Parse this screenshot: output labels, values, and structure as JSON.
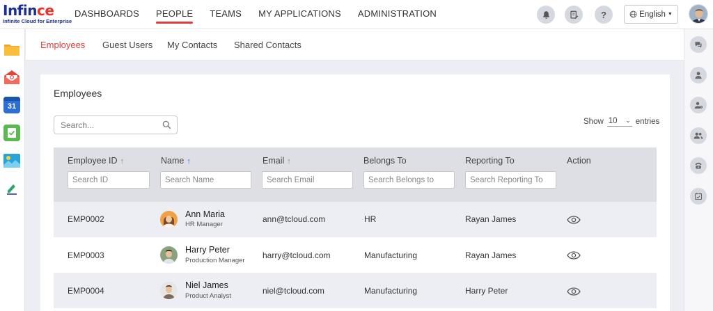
{
  "brand": {
    "name_part1": "Infin",
    "name_part2": "ce",
    "tagline": "Infinite Cloud for Enterprise",
    "accent_color": "#e8342c",
    "primary_color": "#1c2f8c"
  },
  "nav": [
    {
      "label": "DASHBOARDS"
    },
    {
      "label": "PEOPLE",
      "active": true
    },
    {
      "label": "TEAMS"
    },
    {
      "label": "MY APPLICATIONS"
    },
    {
      "label": "ADMINISTRATION"
    }
  ],
  "top_icons": [
    "bell-icon",
    "document-edit-icon",
    "help-icon"
  ],
  "language": {
    "icon": "globe-icon",
    "label": "English"
  },
  "left_apps": [
    "folder-icon",
    "mail-icon",
    "calendar-icon",
    "tasks-icon",
    "gallery-icon",
    "e-sign-icon"
  ],
  "calendar_day": "31",
  "right_icons": [
    "chat-icon",
    "user-icon",
    "user-settings-icon",
    "group-icon",
    "phone-icon",
    "calendar-check-icon"
  ],
  "subtabs": [
    {
      "label": "Employees",
      "active": true
    },
    {
      "label": "Guest Users"
    },
    {
      "label": "My Contacts"
    },
    {
      "label": "Shared Contacts"
    }
  ],
  "card": {
    "title": "Employees",
    "search_placeholder": "Search...",
    "show_label": "Show",
    "entries_value": "10",
    "entries_label": "entries"
  },
  "table": {
    "columns": [
      {
        "label": "Employee ID",
        "sort": true,
        "placeholder": "Search ID"
      },
      {
        "label": "Name",
        "sort": true,
        "sort_active": true,
        "placeholder": "Search Name"
      },
      {
        "label": "Email",
        "sort": true,
        "placeholder": "Search Email"
      },
      {
        "label": "Belongs To",
        "placeholder": "Search Belongs to"
      },
      {
        "label": "Reporting To",
        "placeholder": "Search Reporting To"
      },
      {
        "label": "Action"
      }
    ],
    "rows": [
      {
        "id": "EMP0002",
        "name": "Ann Maria",
        "role": "HR Manager",
        "email": "ann@tcloud.com",
        "belongs_to": "HR",
        "reporting_to": "Rayan James",
        "action_icon": "eye-icon"
      },
      {
        "id": "EMP0003",
        "name": "Harry Peter",
        "role": "Production Manager",
        "email": "harry@tcloud.com",
        "belongs_to": "Manufacturing",
        "reporting_to": "Rayan James",
        "action_icon": "eye-icon"
      },
      {
        "id": "EMP0004",
        "name": "Niel James",
        "role": "Product Analyst",
        "email": "niel@tcloud.com",
        "belongs_to": "Manufacturing",
        "reporting_to": "Harry Peter",
        "action_icon": "eye-icon"
      }
    ]
  }
}
